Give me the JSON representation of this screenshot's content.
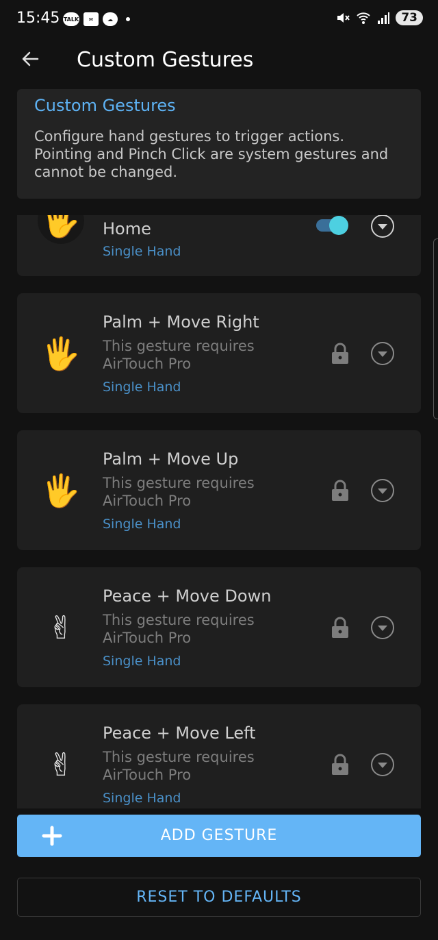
{
  "status_bar": {
    "time": "15:45",
    "notification_icons": [
      "talk-icon",
      "mail-icon",
      "cloud-icon"
    ],
    "battery": "73"
  },
  "app_bar": {
    "title": "Custom Gestures"
  },
  "info": {
    "title": "Custom Gestures",
    "description": "Configure hand gestures to trigger actions. Pointing and Pinch Click are system gestures and cannot be changed."
  },
  "gestures": [
    {
      "name": "Home",
      "hand_type": "Single Hand",
      "emoji": "🖐",
      "enabled": true
    },
    {
      "name": "Palm + Move Right",
      "requirement": "This gesture requires AirTouch Pro",
      "hand_type": "Single Hand",
      "emoji": "🖐",
      "locked": true
    },
    {
      "name": "Palm + Move Up",
      "requirement": "This gesture requires AirTouch Pro",
      "hand_type": "Single Hand",
      "emoji": "🖐",
      "locked": true
    },
    {
      "name": "Peace + Move Down",
      "requirement": "This gesture requires AirTouch Pro",
      "hand_type": "Single Hand",
      "emoji": "✌",
      "locked": true
    },
    {
      "name": "Peace + Move Left",
      "requirement": "This gesture requires AirTouch Pro",
      "hand_type": "Single Hand",
      "emoji": "✌",
      "locked": true
    }
  ],
  "actions": {
    "add_label": "ADD GESTURE",
    "reset_label": "RESET TO DEFAULTS"
  },
  "colors": {
    "accent": "#64b5f6",
    "toggle_on": "#4dd0e1"
  }
}
